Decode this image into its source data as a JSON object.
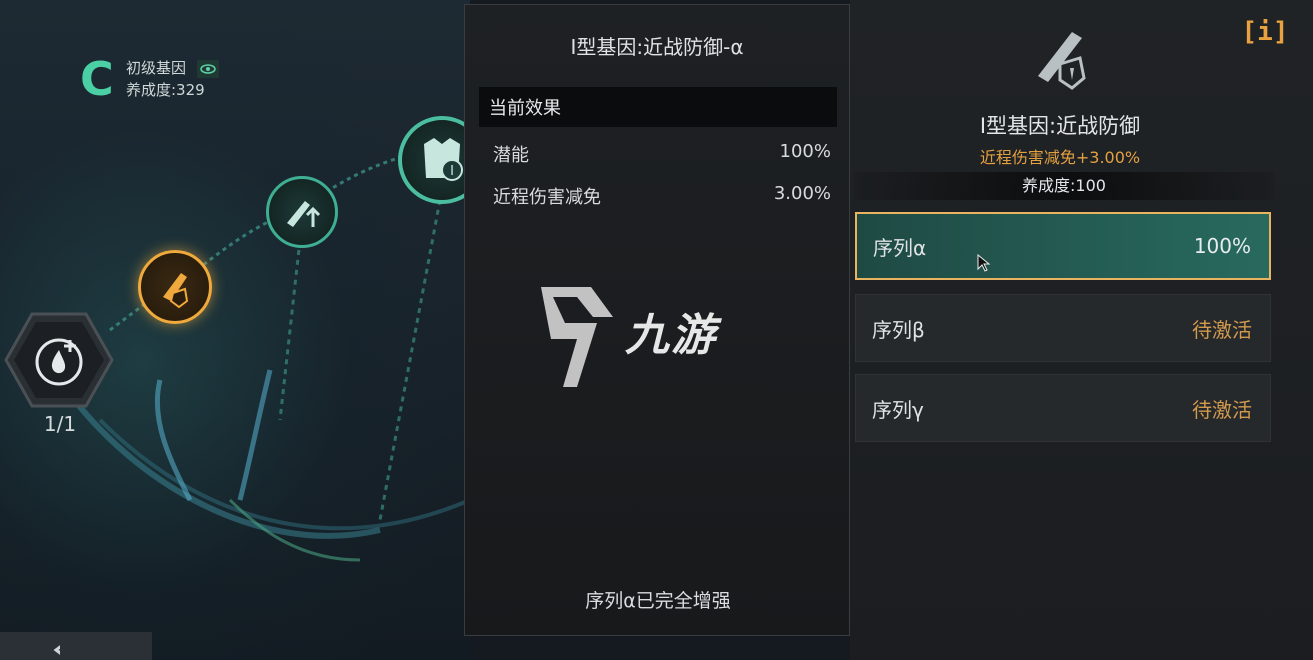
{
  "grade": {
    "letter": "C",
    "name": "初级基因",
    "cultivation": "养成度:329"
  },
  "skill_counter": "1/1",
  "middle_panel": {
    "title": "I型基因:近战防御-α",
    "section_header": "当前效果",
    "stats": [
      {
        "label": "潜能",
        "value": "100%"
      },
      {
        "label": "近程伤害减免",
        "value": "3.00%"
      }
    ],
    "footer": "序列α已完全增强",
    "watermark": "九游"
  },
  "right_panel": {
    "info_button": "[i]",
    "gene_title": "I型基因:近战防御",
    "gene_effect": "近程伤害减免+3.00%",
    "gene_level": "养成度:100",
    "sequences": [
      {
        "name": "序列α",
        "value": "100%",
        "active": true
      },
      {
        "name": "序列β",
        "value": "待激活",
        "active": false
      },
      {
        "name": "序列γ",
        "value": "待激活",
        "active": false
      }
    ]
  },
  "colors": {
    "accent_green": "#4ad0a4",
    "accent_orange": "#e8b460",
    "inactive_text": "#d29a4c"
  },
  "icons": [
    "eye-icon",
    "water-drop-plus-icon",
    "knife-shield-icon",
    "knife-arrow-icon",
    "armor-icon",
    "back-arrow-icon",
    "cursor-icon"
  ]
}
